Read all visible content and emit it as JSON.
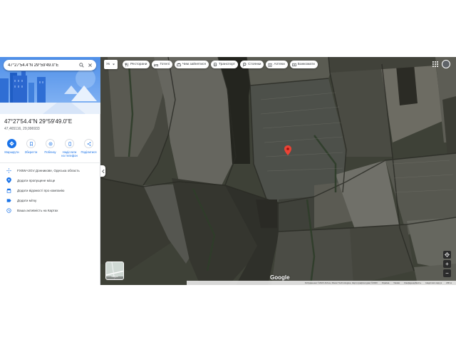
{
  "search": {
    "value": "47°27'54.4\"N 29°59'49.0\"E"
  },
  "place": {
    "title": "47°27'54.4\"N 29°59'49.0\"E",
    "subtitle": "47,465116, 29,996933"
  },
  "actions": [
    {
      "label": "Маршрути",
      "icon": "directions-icon"
    },
    {
      "label": "Зберегти",
      "icon": "bookmark-icon"
    },
    {
      "label": "Поблизу",
      "icon": "nearby-icon"
    },
    {
      "label": "Надіслати на телефон",
      "icon": "phone-icon"
    },
    {
      "label": "Поділитися",
      "icon": "share-icon"
    }
  ],
  "info": [
    {
      "text": "FX8W+2GV Донникове, Одеська область",
      "icon": "plus-code-icon"
    },
    {
      "text": "Додати пропущене місце",
      "icon": "add-place-icon"
    },
    {
      "text": "Додати відомості про компанію",
      "icon": "business-icon"
    },
    {
      "text": "Додати мітку",
      "icon": "label-icon"
    },
    {
      "text": "Ваша активність на Картах",
      "icon": "history-icon"
    }
  ],
  "map": {
    "lang_chip": "Ук",
    "chips": [
      {
        "label": "Ресторани",
        "icon": "restaurant-icon"
      },
      {
        "label": "Готелі",
        "icon": "hotel-icon"
      },
      {
        "label": "Чим зайнятися",
        "icon": "things-to-do-icon"
      },
      {
        "label": "Транспорт",
        "icon": "transit-icon"
      },
      {
        "label": "Стоянки",
        "icon": "parking-icon"
      },
      {
        "label": "Аптеки",
        "icon": "pharmacy-icon"
      },
      {
        "label": "Банкомати",
        "icon": "atm-icon"
      }
    ],
    "layers_label": "Шари",
    "logo": "Google",
    "attribution": [
      "Зображення ©2023 Airbus, Maxar Technologies, Картографічні дані ©2023",
      "Україна",
      "Умови",
      "Конфіденційність",
      "Надіслати відгук",
      "200 м"
    ],
    "controls": {
      "zoom_in": "+",
      "zoom_out": "−"
    },
    "colors": {
      "pin": "#ea4335",
      "accent": "#1a73e8"
    }
  }
}
